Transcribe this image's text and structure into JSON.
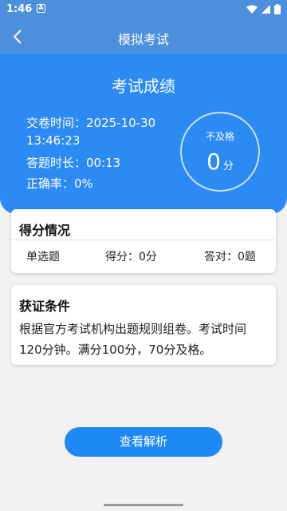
{
  "status_bar": {
    "time": "1:46",
    "notif": "A"
  },
  "app_bar": {
    "title": "模拟考试"
  },
  "hero": {
    "title": "考试成绩",
    "submit_time_line1": "交卷时间：2025-10-30",
    "submit_time_line2": "13:46:23",
    "duration": "答题时长：00:13",
    "accuracy": "正确率：0%",
    "score_status": "不及格",
    "score_value": "0",
    "score_unit": "分"
  },
  "score_card": {
    "title": "得分情况",
    "category": "单选题",
    "score": "得分：0分",
    "correct": "答对：0题"
  },
  "cert_card": {
    "title": "获证条件",
    "description": "根据官方考试机构出题规则组卷。考试时间120分钟。满分100分，70分及格。"
  },
  "actions": {
    "view_analysis": "查看解析"
  },
  "colors": {
    "app_bar": "#4c8fdc",
    "hero": "#2b8af3",
    "button": "#1e88f5"
  }
}
